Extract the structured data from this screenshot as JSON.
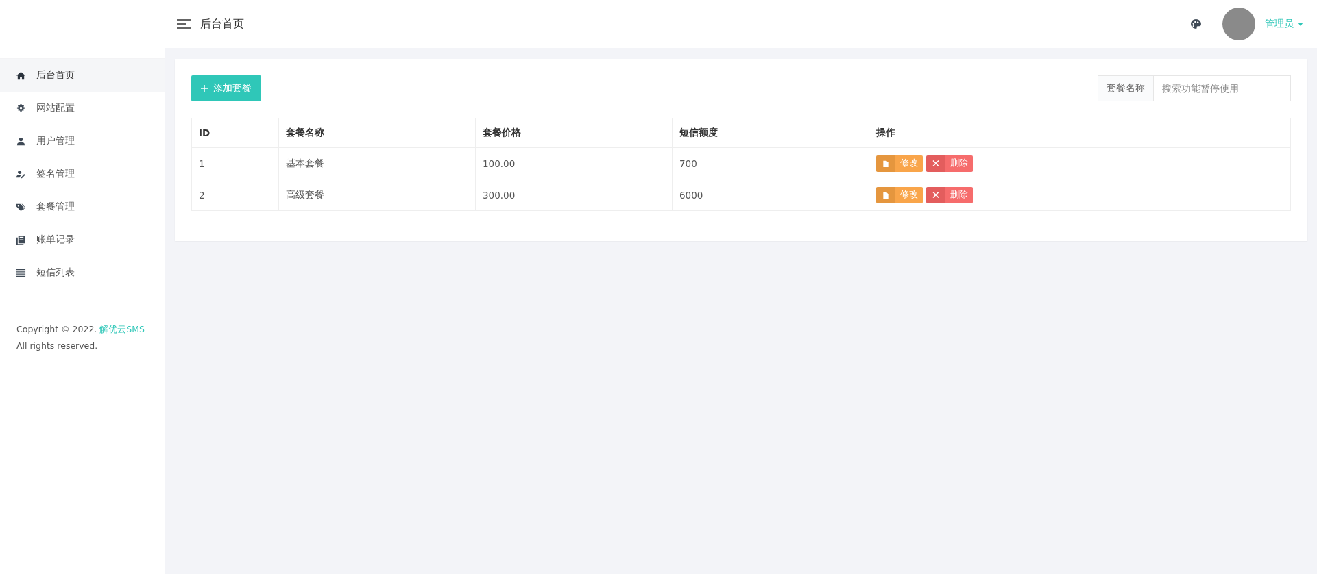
{
  "sidebar": {
    "items": [
      {
        "label": "后台首页",
        "selected": true
      },
      {
        "label": "网站配置",
        "selected": false
      },
      {
        "label": "用户管理",
        "selected": false
      },
      {
        "label": "签名管理",
        "selected": false
      },
      {
        "label": "套餐管理",
        "selected": false
      },
      {
        "label": "账单记录",
        "selected": false
      },
      {
        "label": "短信列表",
        "selected": false
      }
    ],
    "copyright": "Copyright © 2022.",
    "brand": "解优云SMS",
    "rights": "All rights reserved."
  },
  "header": {
    "title": "后台首页",
    "user": "管理员"
  },
  "toolbar": {
    "add_button": "添加套餐",
    "search_label": "套餐名称",
    "search_placeholder": "搜索功能暂停使用"
  },
  "table": {
    "columns": [
      "ID",
      "套餐名称",
      "套餐价格",
      "短信额度",
      "操作"
    ],
    "rows": [
      {
        "cells": [
          "1",
          "基本套餐",
          "100.00",
          "700"
        ],
        "actions": [
          {
            "kind": "edit",
            "label": "修改"
          },
          {
            "kind": "delete",
            "label": "删除"
          }
        ]
      },
      {
        "cells": [
          "2",
          "高级套餐",
          "300.00",
          "6000"
        ],
        "actions": [
          {
            "kind": "edit",
            "label": "修改"
          },
          {
            "kind": "delete",
            "label": "删除"
          }
        ]
      }
    ]
  }
}
